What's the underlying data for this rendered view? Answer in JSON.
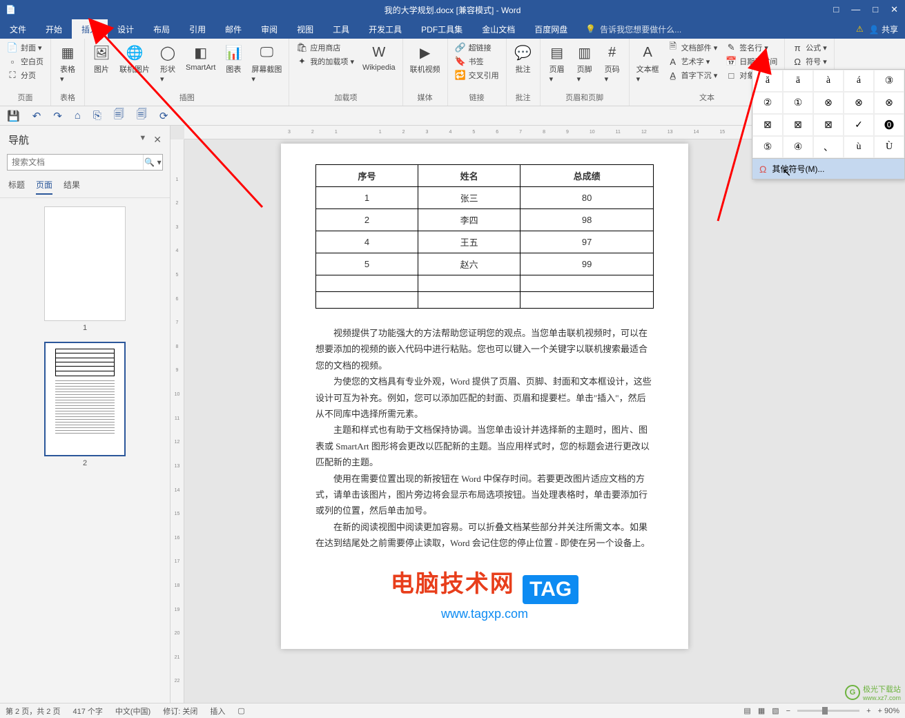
{
  "title": "我的大学规划.docx [兼容模式] - Word",
  "window": {
    "tray": "□",
    "min": "—",
    "max": "□",
    "close": "✕"
  },
  "menutabs": {
    "items": [
      "文件",
      "开始",
      "插入",
      "设计",
      "布局",
      "引用",
      "邮件",
      "审阅",
      "视图",
      "工具",
      "开发工具",
      "PDF工具集",
      "金山文档",
      "百度网盘"
    ],
    "active_index": 2,
    "tellme_placeholder": "告诉我您想要做什么...",
    "share": "共享"
  },
  "ribbon": {
    "groups": [
      {
        "label": "页面",
        "cols": [
          {
            "type": "vstack",
            "rows": [
              {
                "icon": "📄",
                "text": "封面 ▾"
              },
              {
                "icon": "▫",
                "text": "空白页"
              },
              {
                "icon": "⛶",
                "text": "分页"
              }
            ]
          }
        ]
      },
      {
        "label": "表格",
        "cols": [
          {
            "type": "big",
            "icon": "▦",
            "text": "表格\n▾"
          }
        ]
      },
      {
        "label": "插图",
        "cols": [
          {
            "type": "big",
            "icon": "🖼",
            "text": "图片"
          },
          {
            "type": "big",
            "icon": "🌐",
            "text": "联机图片"
          },
          {
            "type": "big",
            "icon": "◯",
            "text": "形状\n▾"
          },
          {
            "type": "big",
            "icon": "◧",
            "text": "SmartArt"
          },
          {
            "type": "big",
            "icon": "📊",
            "text": "图表"
          },
          {
            "type": "big",
            "icon": "🖵",
            "text": "屏幕截图\n▾"
          }
        ]
      },
      {
        "label": "加载项",
        "cols": [
          {
            "type": "vstack",
            "rows": [
              {
                "icon": "🛍",
                "text": "应用商店"
              },
              {
                "icon": "✦",
                "text": "我的加载项 ▾"
              }
            ]
          },
          {
            "type": "big",
            "icon": "W",
            "text": "Wikipedia"
          }
        ]
      },
      {
        "label": "媒体",
        "cols": [
          {
            "type": "big",
            "icon": "▶",
            "text": "联机视频"
          }
        ]
      },
      {
        "label": "链接",
        "cols": [
          {
            "type": "vstack",
            "rows": [
              {
                "icon": "🔗",
                "text": "超链接"
              },
              {
                "icon": "🔖",
                "text": "书签"
              },
              {
                "icon": "🔁",
                "text": "交叉引用"
              }
            ]
          }
        ]
      },
      {
        "label": "批注",
        "cols": [
          {
            "type": "big",
            "icon": "💬",
            "text": "批注"
          }
        ]
      },
      {
        "label": "页眉和页脚",
        "cols": [
          {
            "type": "big",
            "icon": "▤",
            "text": "页眉\n▾"
          },
          {
            "type": "big",
            "icon": "▥",
            "text": "页脚\n▾"
          },
          {
            "type": "big",
            "icon": "#",
            "text": "页码\n▾"
          }
        ]
      },
      {
        "label": "文本",
        "cols": [
          {
            "type": "big",
            "icon": "A",
            "text": "文本框\n▾"
          },
          {
            "type": "vstack",
            "rows": [
              {
                "icon": "🗎",
                "text": "文档部件 ▾"
              },
              {
                "icon": "A",
                "text": "艺术字 ▾"
              },
              {
                "icon": "A̲",
                "text": "首字下沉 ▾"
              }
            ]
          },
          {
            "type": "vstack",
            "rows": [
              {
                "icon": "✎",
                "text": "签名行 ▾"
              },
              {
                "icon": "📅",
                "text": "日期和时间"
              },
              {
                "icon": "□",
                "text": "对象 ▾"
              }
            ]
          }
        ]
      },
      {
        "label": "符号",
        "cols": [
          {
            "type": "vstack",
            "rows": [
              {
                "icon": "π",
                "text": "公式  ▾"
              },
              {
                "icon": "Ω",
                "text": "符号 ▾"
              }
            ]
          }
        ]
      }
    ]
  },
  "symbol_panel": {
    "grid": [
      "ă",
      "ā",
      "à",
      "á",
      "③",
      "②",
      "①",
      "⊗",
      "⊗",
      "⊗",
      "⊠",
      "⊠",
      "⊠",
      "✓",
      "⓿",
      "⑤",
      "④",
      "、",
      "ù",
      "Ù"
    ],
    "more": "其他符号(M)..."
  },
  "qat": [
    "💾",
    "↶",
    "↷",
    "⌂",
    "⎘",
    "🗐",
    "🗐",
    "⟳"
  ],
  "nav": {
    "title": "导航",
    "search_placeholder": "搜索文档",
    "tabs": [
      "标题",
      "页面",
      "结果"
    ],
    "active_tab": 1,
    "pages": [
      1,
      2
    ]
  },
  "doc": {
    "table": {
      "headers": [
        "序号",
        "姓名",
        "总成绩"
      ],
      "rows": [
        [
          "1",
          "张三",
          "80"
        ],
        [
          "2",
          "李四",
          "98"
        ],
        [
          "4",
          "王五",
          "97"
        ],
        [
          "5",
          "赵六",
          "99"
        ],
        [
          "",
          "",
          ""
        ],
        [
          "",
          "",
          ""
        ]
      ]
    },
    "paragraphs": [
      "视频提供了功能强大的方法帮助您证明您的观点。当您单击联机视频时，可以在想要添加的视频的嵌入代码中进行粘贴。您也可以键入一个关键字以联机搜索最适合您的文档的视频。",
      "为使您的文档具有专业外观，Word 提供了页眉、页脚、封面和文本框设计，这些设计可互为补充。例如，您可以添加匹配的封面、页眉和提要栏。单击\"插入\"，然后从不同库中选择所需元素。",
      "主题和样式也有助于文档保持协调。当您单击设计并选择新的主题时，图片、图表或 SmartArt 图形将会更改以匹配新的主题。当应用样式时，您的标题会进行更改以匹配新的主题。",
      "使用在需要位置出现的新按钮在 Word 中保存时间。若要更改图片适应文档的方式，请单击该图片，图片旁边将会显示布局选项按钮。当处理表格时，单击要添加行或列的位置，然后单击加号。",
      "在新的阅读视图中阅读更加容易。可以折叠文档某些部分并关注所需文本。如果在达到结尾处之前需要停止读取，Word 会记住您的停止位置 - 即使在另一个设备上。"
    ],
    "watermark": {
      "line1": "电脑技术网",
      "tag": "TAG",
      "line2": "www.tagxp.com"
    }
  },
  "status": {
    "page": "第 2 页，共 2 页",
    "words": "417 个字",
    "lang": "中文(中国)",
    "track": "修订: 关闭",
    "mode": "插入",
    "zoom": "+ 90%"
  },
  "dl_logo": {
    "brand": "极光下载站",
    "url": "www.xz7.com"
  },
  "hruler_ticks": [
    "3",
    "2",
    "1",
    "",
    "1",
    "2",
    "3",
    "4",
    "5",
    "6",
    "7",
    "8",
    "9",
    "10",
    "11",
    "12",
    "13",
    "14",
    "15"
  ],
  "vruler_ticks": [
    "",
    "1",
    "2",
    "3",
    "4",
    "5",
    "6",
    "7",
    "8",
    "9",
    "10",
    "11",
    "12",
    "13",
    "14",
    "15",
    "16",
    "17",
    "18",
    "19",
    "20",
    "21",
    "22"
  ]
}
